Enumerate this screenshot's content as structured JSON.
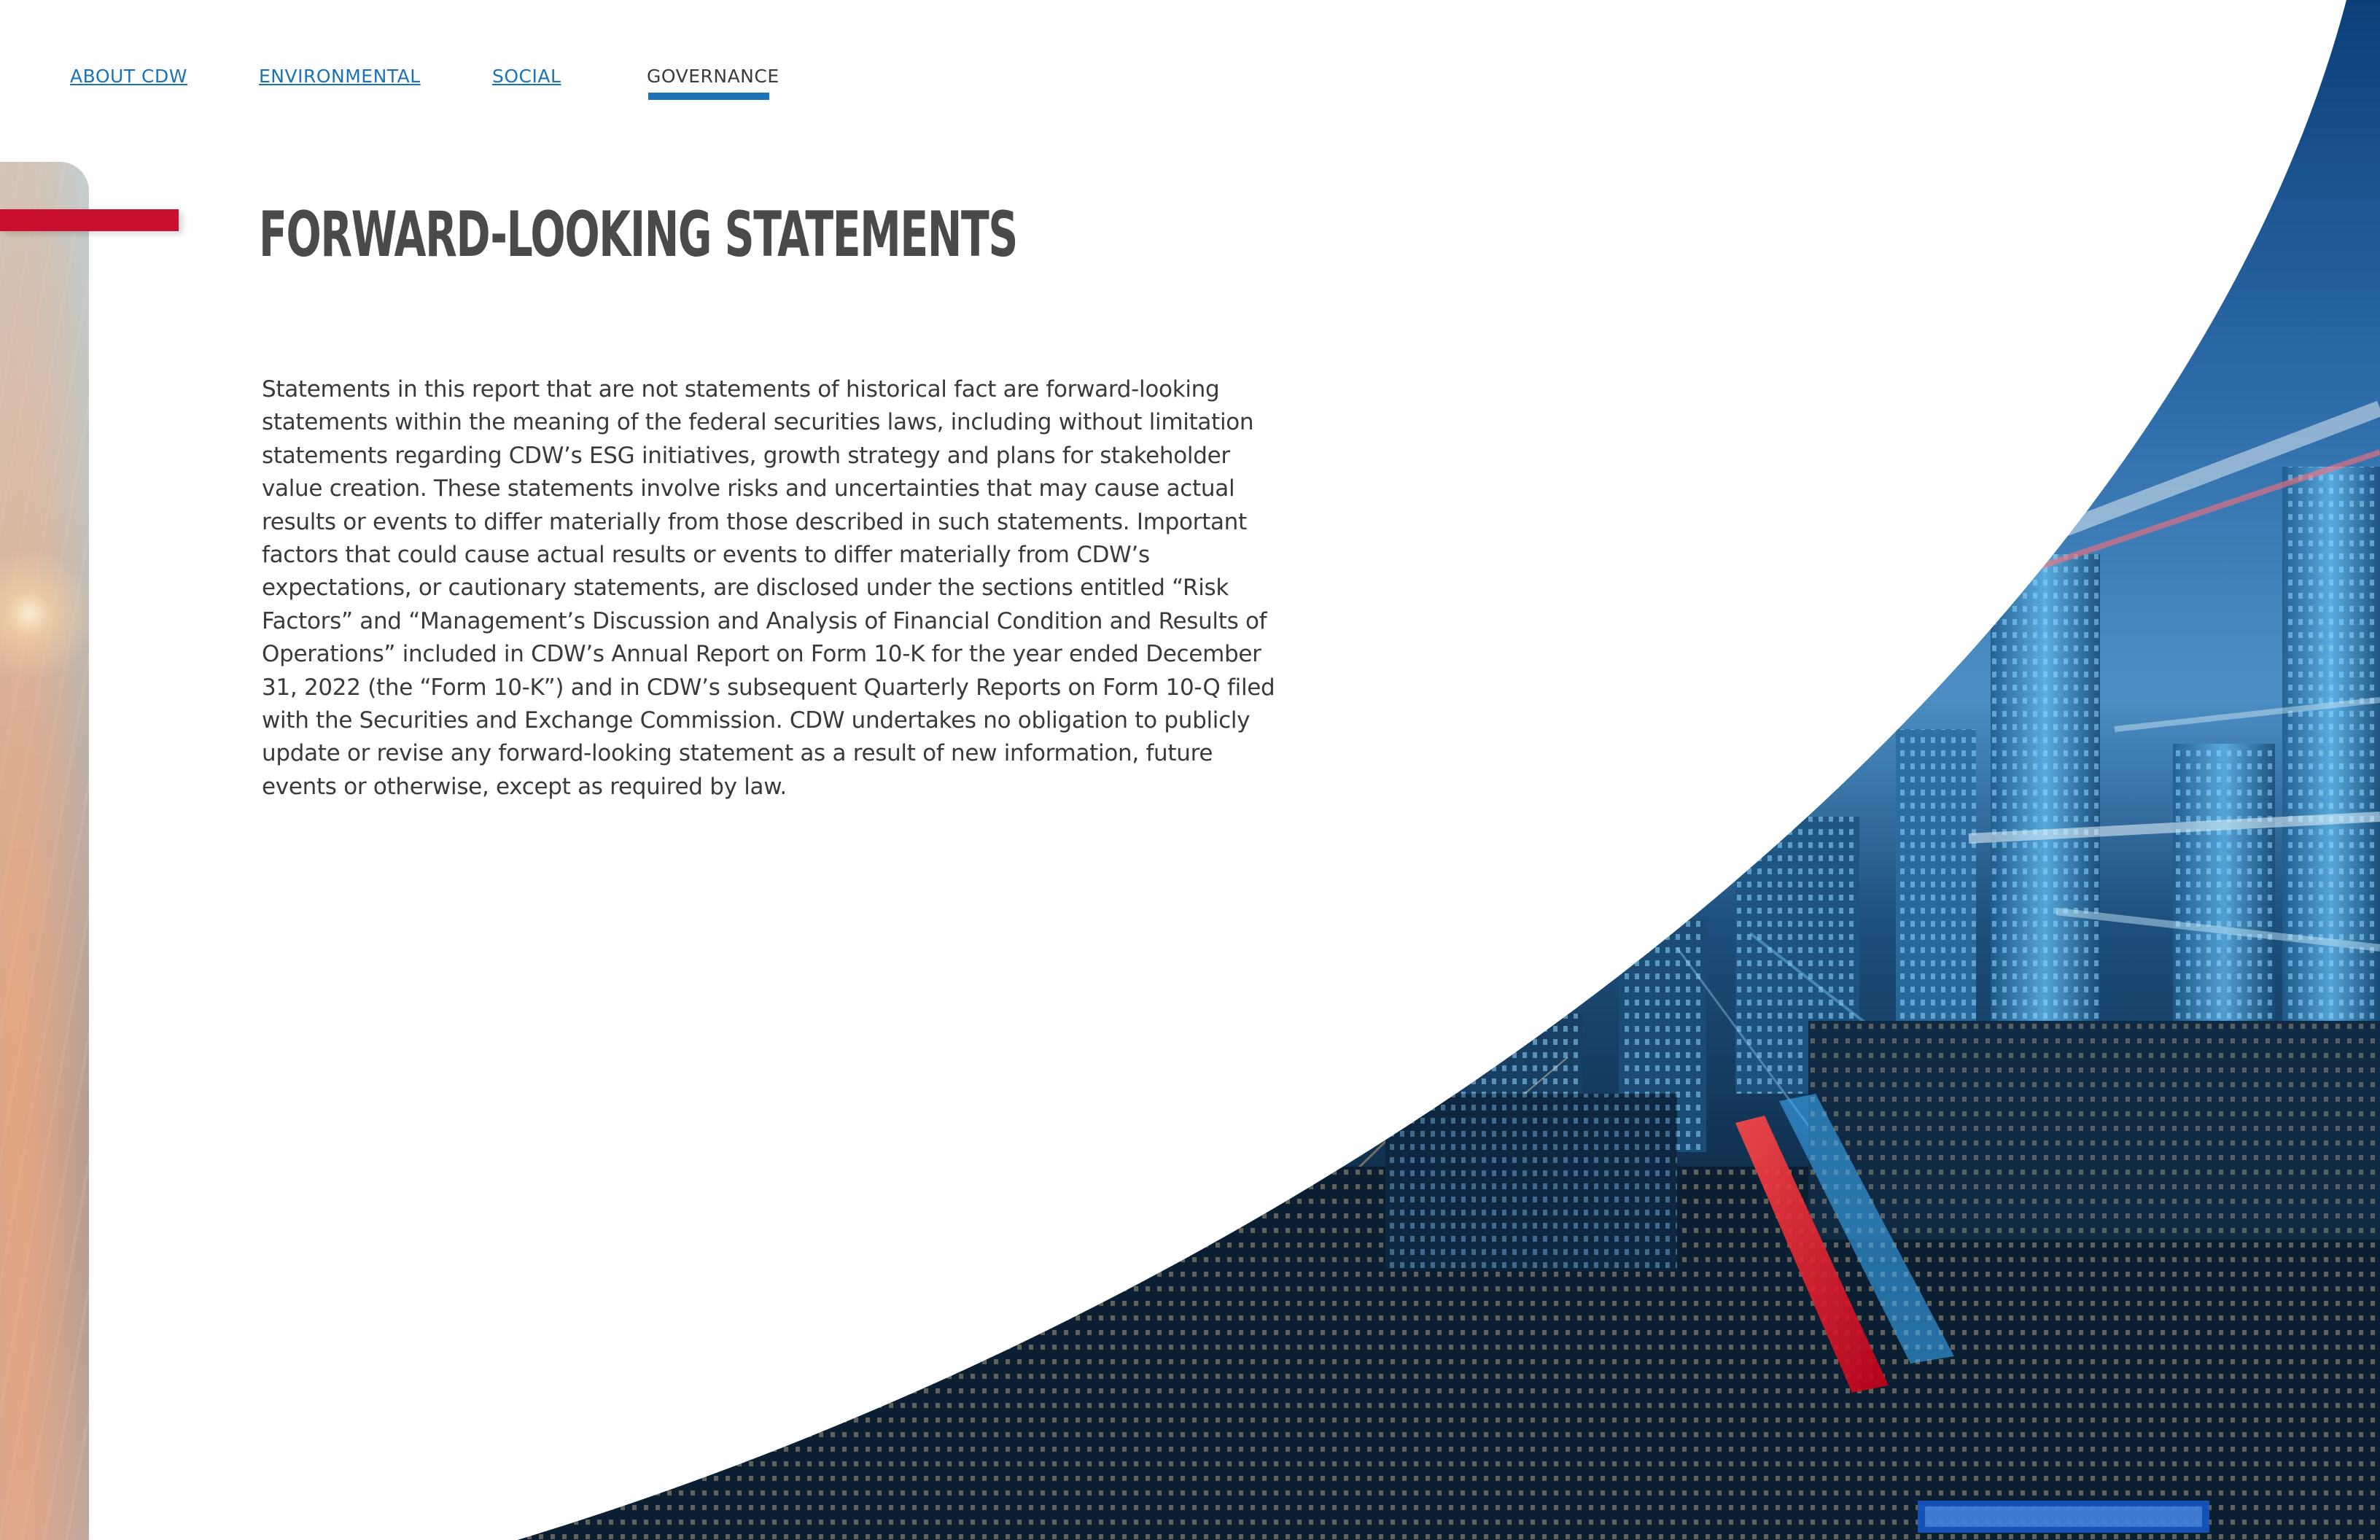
{
  "nav": {
    "items": [
      {
        "label": "ABOUT CDW",
        "active": false
      },
      {
        "label": "ENVIRONMENTAL",
        "active": false
      },
      {
        "label": "SOCIAL",
        "active": false
      },
      {
        "label": "GOVERNANCE",
        "active": true
      }
    ]
  },
  "page": {
    "title": "FORWARD-LOOKING STATEMENTS",
    "body": "Statements in this report that are not statements of historical fact are forward-looking statements within the meaning of the federal securities laws, including without limitation statements regarding CDW’s ESG initiatives, growth strategy and plans for stakeholder value creation. These statements involve risks and uncertainties that may cause actual results or events to differ materially from those described in such statements. Important factors that could cause actual results or events to differ materially from CDW’s expectations, or cautionary statements, are disclosed under the sections entitled “Risk Factors” and “Management’s Discussion and Analysis of Financial Condition and Results of Operations” included in CDW’s Annual Report on Form 10-K for the year ended December 31, 2022 (the “Form 10-K”) and in CDW’s subsequent Quarterly Reports on Form 10-Q filed with the Securities and Exchange Commission. CDW undertakes no obligation to publicly update or revise any forward-looking statement as a result of new information, future events or otherwise, except as required by law."
  },
  "colors": {
    "nav_link": "#1a73b8",
    "nav_active": "#3b3b3b",
    "accent_red": "#c8102e",
    "title": "#4a4a4a",
    "body_text": "#3a3a3a"
  },
  "decor": {
    "side_panel": "blurred-city-image",
    "right_panel": "night-city-skyline-image"
  }
}
